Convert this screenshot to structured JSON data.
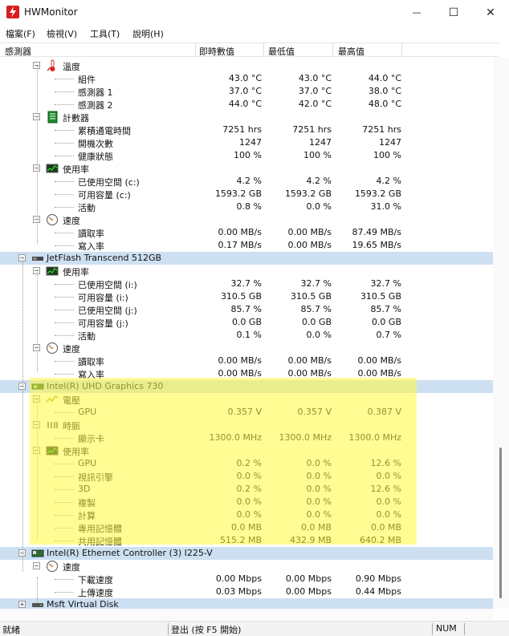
{
  "window": {
    "title": "HWMonitor",
    "minimize_glyph": "—",
    "maximize_glyph": "☐",
    "close_glyph": "✕"
  },
  "menu": [
    "檔案(F)",
    "檢視(V)",
    "工具(T)",
    "說明(H)"
  ],
  "columns": {
    "sensor": "感測器",
    "value": "即時數值",
    "min": "最低值",
    "max": "最高值"
  },
  "tree": [
    {
      "depth": 2,
      "type": "group",
      "icon": "thermometer-icon",
      "label": "溫度",
      "expander": "−"
    },
    {
      "depth": 3,
      "type": "sensor",
      "label": "組件",
      "value": "43.0 °C",
      "min": "43.0 °C",
      "max": "44.0 °C"
    },
    {
      "depth": 3,
      "type": "sensor",
      "label": "感測器 1",
      "value": "37.0 °C",
      "min": "37.0 °C",
      "max": "38.0 °C"
    },
    {
      "depth": 3,
      "type": "sensor",
      "label": "感測器 2",
      "value": "44.0 °C",
      "min": "42.0 °C",
      "max": "48.0 °C"
    },
    {
      "depth": 2,
      "type": "group",
      "icon": "counter-icon",
      "label": "計數器",
      "expander": "−"
    },
    {
      "depth": 3,
      "type": "sensor",
      "label": "累積通電時間",
      "value": "7251 hrs",
      "min": "7251 hrs",
      "max": "7251 hrs"
    },
    {
      "depth": 3,
      "type": "sensor",
      "label": "開機次數",
      "value": "1247",
      "min": "1247",
      "max": "1247"
    },
    {
      "depth": 3,
      "type": "sensor",
      "label": "健康狀態",
      "value": "100 %",
      "min": "100 %",
      "max": "100 %"
    },
    {
      "depth": 2,
      "type": "group",
      "icon": "utilization-icon",
      "label": "使用率",
      "expander": "−"
    },
    {
      "depth": 3,
      "type": "sensor",
      "label": "已使用空間 (c:)",
      "value": "4.2 %",
      "min": "4.2 %",
      "max": "4.2 %"
    },
    {
      "depth": 3,
      "type": "sensor",
      "label": "可用容量 (c:)",
      "value": "1593.2 GB",
      "min": "1593.2 GB",
      "max": "1593.2 GB"
    },
    {
      "depth": 3,
      "type": "sensor",
      "label": "活動",
      "value": "0.8 %",
      "min": "0.0 %",
      "max": "31.0 %"
    },
    {
      "depth": 2,
      "type": "group",
      "icon": "speed-gauge-icon",
      "label": "速度",
      "expander": "−"
    },
    {
      "depth": 3,
      "type": "sensor",
      "label": "讀取率",
      "value": "0.00 MB/s",
      "min": "0.00 MB/s",
      "max": "87.49 MB/s"
    },
    {
      "depth": 3,
      "type": "sensor",
      "label": "寫入率",
      "value": "0.17 MB/s",
      "min": "0.00 MB/s",
      "max": "19.65 MB/s"
    },
    {
      "depth": 1,
      "type": "device",
      "icon": "usb-drive-icon",
      "label": "JetFlash Transcend 512GB",
      "expander": "−",
      "selected": true
    },
    {
      "depth": 2,
      "type": "group",
      "icon": "utilization-icon",
      "label": "使用率",
      "expander": "−"
    },
    {
      "depth": 3,
      "type": "sensor",
      "label": "已使用空間 (i:)",
      "value": "32.7 %",
      "min": "32.7 %",
      "max": "32.7 %"
    },
    {
      "depth": 3,
      "type": "sensor",
      "label": "可用容量 (i:)",
      "value": "310.5 GB",
      "min": "310.5 GB",
      "max": "310.5 GB"
    },
    {
      "depth": 3,
      "type": "sensor",
      "label": "已使用空間 (j:)",
      "value": "85.7 %",
      "min": "85.7 %",
      "max": "85.7 %"
    },
    {
      "depth": 3,
      "type": "sensor",
      "label": "可用容量 (j:)",
      "value": "0.0 GB",
      "min": "0.0 GB",
      "max": "0.0 GB"
    },
    {
      "depth": 3,
      "type": "sensor",
      "label": "活動",
      "value": "0.1 %",
      "min": "0.0 %",
      "max": "0.7 %"
    },
    {
      "depth": 2,
      "type": "group",
      "icon": "speed-gauge-icon",
      "label": "速度",
      "expander": "−"
    },
    {
      "depth": 3,
      "type": "sensor",
      "label": "讀取率",
      "value": "0.00 MB/s",
      "min": "0.00 MB/s",
      "max": "0.00 MB/s"
    },
    {
      "depth": 3,
      "type": "sensor",
      "label": "寫入率",
      "value": "0.00 MB/s",
      "min": "0.00 MB/s",
      "max": "0.00 MB/s"
    },
    {
      "depth": 1,
      "type": "device",
      "icon": "gpu-icon",
      "label": "Intel(R) UHD Graphics 730",
      "expander": "−",
      "selected": true
    },
    {
      "depth": 2,
      "type": "group",
      "icon": "voltage-icon",
      "label": "電壓",
      "expander": "−"
    },
    {
      "depth": 3,
      "type": "sensor",
      "label": "GPU",
      "value": "0.357 V",
      "min": "0.357 V",
      "max": "0.387 V"
    },
    {
      "depth": 2,
      "type": "group",
      "icon": "clock-icon",
      "label": "時脈",
      "expander": "−"
    },
    {
      "depth": 3,
      "type": "sensor",
      "label": "顯示卡",
      "value": "1300.0 MHz",
      "min": "1300.0 MHz",
      "max": "1300.0 MHz"
    },
    {
      "depth": 2,
      "type": "group",
      "icon": "utilization-icon",
      "label": "使用率",
      "expander": "−"
    },
    {
      "depth": 3,
      "type": "sensor",
      "label": "GPU",
      "value": "0.2 %",
      "min": "0.0 %",
      "max": "12.6 %"
    },
    {
      "depth": 3,
      "type": "sensor",
      "label": "視訊引擎",
      "value": "0.0 %",
      "min": "0.0 %",
      "max": "0.0 %"
    },
    {
      "depth": 3,
      "type": "sensor",
      "label": "3D",
      "value": "0.2 %",
      "min": "0.0 %",
      "max": "12.6 %"
    },
    {
      "depth": 3,
      "type": "sensor",
      "label": "複製",
      "value": "0.0 %",
      "min": "0.0 %",
      "max": "0.0 %"
    },
    {
      "depth": 3,
      "type": "sensor",
      "label": "計算",
      "value": "0.0 %",
      "min": "0.0 %",
      "max": "0.0 %"
    },
    {
      "depth": 3,
      "type": "sensor",
      "label": "專用記憶體",
      "value": "0.0 MB",
      "min": "0.0 MB",
      "max": "0.0 MB"
    },
    {
      "depth": 3,
      "type": "sensor",
      "label": "共用記憶體",
      "value": "515.2 MB",
      "min": "432.9 MB",
      "max": "640.2 MB"
    },
    {
      "depth": 1,
      "type": "device",
      "icon": "network-card-icon",
      "label": "Intel(R) Ethernet Controller (3) I225-V",
      "expander": "−",
      "selected": true
    },
    {
      "depth": 2,
      "type": "group",
      "icon": "speed-gauge-icon",
      "label": "速度",
      "expander": "−"
    },
    {
      "depth": 3,
      "type": "sensor",
      "label": "下載速度",
      "value": "0.00 Mbps",
      "min": "0.00 Mbps",
      "max": "0.90 Mbps"
    },
    {
      "depth": 3,
      "type": "sensor",
      "label": "上傳速度",
      "value": "0.03 Mbps",
      "min": "0.00 Mbps",
      "max": "0.44 Mbps"
    },
    {
      "depth": 1,
      "type": "device",
      "icon": "disk-icon",
      "label": "Msft    Virtual Disk",
      "expander": "+",
      "selected": true
    }
  ],
  "status": {
    "left": "就緒",
    "center": "登出 (按 F5 開始)",
    "right": "NUM"
  },
  "colors": {
    "selection": "#cde0f2",
    "highlight": "#fffa3c",
    "app_icon": "#d81e1e"
  }
}
